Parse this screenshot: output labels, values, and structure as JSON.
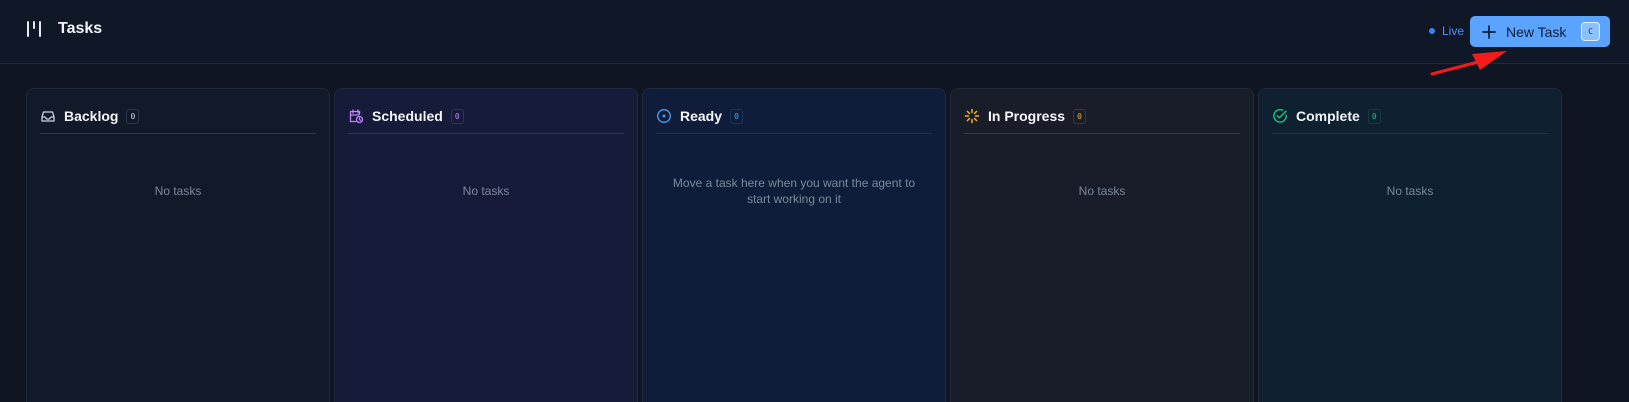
{
  "header": {
    "title": "Tasks",
    "status": "Live",
    "new_task_label": "New Task",
    "shortcut": "C"
  },
  "columns": [
    {
      "title": "Backlog",
      "count": "0",
      "empty_text": "No tasks",
      "icon": "inbox-icon",
      "accent": "#cbd5e1",
      "bg": "#121a2a",
      "line": "#2c3648"
    },
    {
      "title": "Scheduled",
      "count": "0",
      "empty_text": "No tasks",
      "icon": "calendar-clock-icon",
      "accent": "#c084fc",
      "bg": "#151b39",
      "line": "#3b2f5c"
    },
    {
      "title": "Ready",
      "count": "0",
      "empty_text": "Move a task here when you want the agent to start working on it",
      "icon": "target-circle-icon",
      "accent": "#4aa3ff",
      "bg": "#101d3a",
      "line": "#17345d"
    },
    {
      "title": "In Progress",
      "count": "0",
      "empty_text": "No tasks",
      "icon": "spinner-icon",
      "accent": "#f5b22a",
      "bg": "#181d29",
      "line": "#4b3524"
    },
    {
      "title": "Complete",
      "count": "0",
      "empty_text": "No tasks",
      "icon": "check-circle-icon",
      "accent": "#10c987",
      "bg": "#0f2031",
      "line": "#163c43"
    }
  ]
}
